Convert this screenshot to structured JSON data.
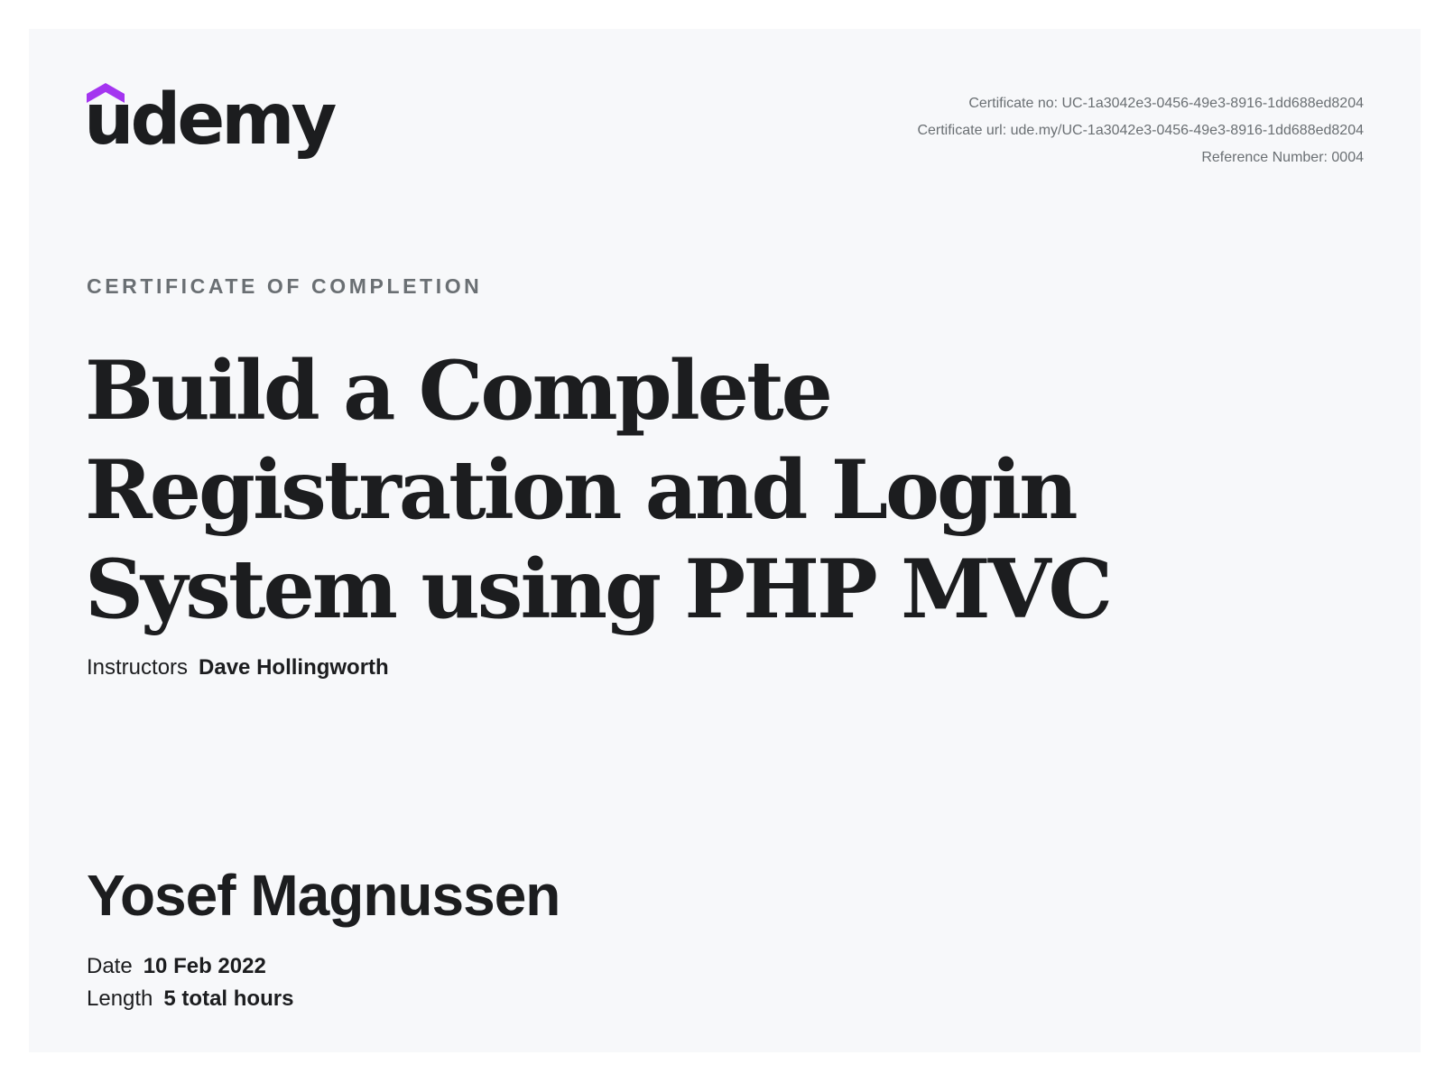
{
  "brand": {
    "logo_text": "udemy",
    "accent_color": "#a435f0",
    "text_color": "#1c1d1f"
  },
  "meta": {
    "certificate_no": "Certificate no: UC-1a3042e3-0456-49e3-8916-1dd688ed8204",
    "certificate_url": "Certificate url: ude.my/UC-1a3042e3-0456-49e3-8916-1dd688ed8204",
    "reference_number": "Reference Number: 0004"
  },
  "certificate": {
    "heading": "CERTIFICATE OF COMPLETION",
    "course_title": "Build a Complete Registration and Login System using PHP MVC",
    "instructors_label": "Instructors",
    "instructors_value": "Dave Hollingworth",
    "student_name": "Yosef Magnussen",
    "date_label": "Date",
    "date_value": "10 Feb 2022",
    "length_label": "Length",
    "length_value": "5 total hours"
  }
}
